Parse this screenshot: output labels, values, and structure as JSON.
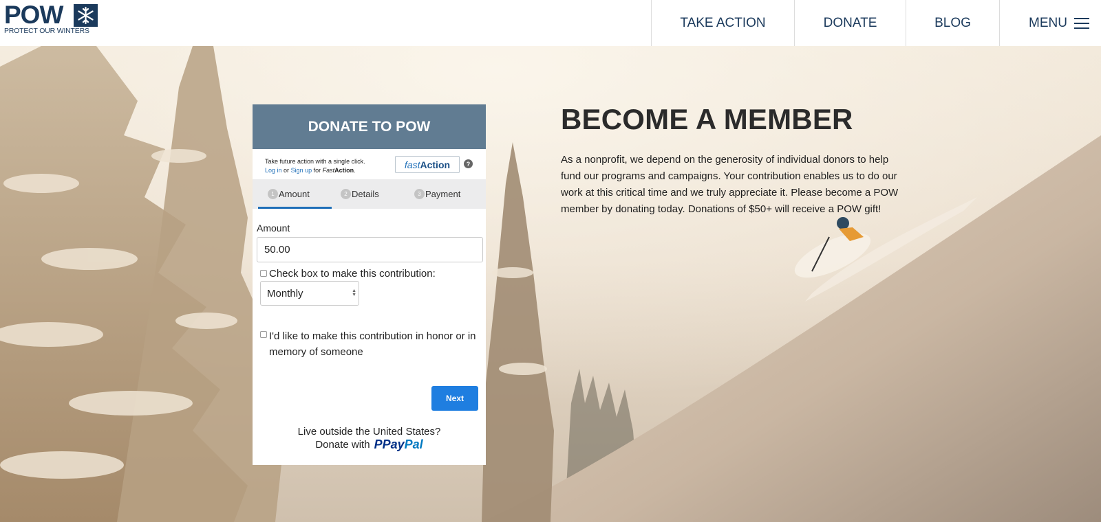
{
  "brand": {
    "logo_text": "POW",
    "logo_tagline": "PROTECT OUR WINTERS"
  },
  "nav": {
    "take_action": "TAKE ACTION",
    "donate": "DONATE",
    "blog": "BLOG",
    "menu": "MENU"
  },
  "donation_form": {
    "title": "DONATE TO POW",
    "fastaction": {
      "prompt": "Take future action with a single click.",
      "login": "Log in",
      "or": "or",
      "signup": "Sign up",
      "for": "for",
      "brand_italic": "Fast",
      "brand_bold": "Action",
      "badge_fast": "fast",
      "badge_action": "Action",
      "help": "?"
    },
    "steps": [
      {
        "num": "1",
        "label": "Amount"
      },
      {
        "num": "2",
        "label": "Details"
      },
      {
        "num": "3",
        "label": "Payment"
      }
    ],
    "active_step": "Amount",
    "amount_label": "Amount",
    "amount_value": "50.00",
    "recurring_label": "Check box to make this contribution:",
    "recurring_checked": false,
    "frequency": "Monthly",
    "honor_label": "I'd like to make this contribution in honor or in memory of someone",
    "honor_checked": false,
    "next_button": "Next",
    "international_question": "Live outside the United States?",
    "international_action": "Donate with",
    "paypal_pay": "Pay",
    "paypal_pal": "Pal",
    "paypal_mark": "P"
  },
  "membership": {
    "headline": "BECOME A MEMBER",
    "body": "As a nonprofit, we depend on the generosity of individual donors to help fund our programs and campaigns. Your contribution enables us to do our work at this critical time and we truly appreciate it. Please become a POW member by donating today. Donations of $50+ will receive a POW gift!"
  },
  "colors": {
    "brand_navy": "#1b3a5c",
    "form_header": "#617c92",
    "next_button": "#1f7ee0",
    "link_blue": "#1f6fb8"
  }
}
